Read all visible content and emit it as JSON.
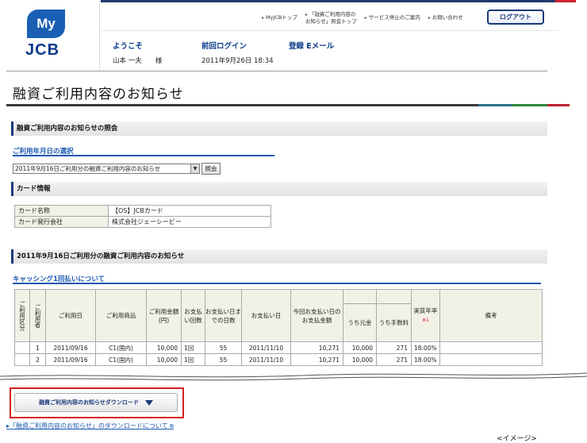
{
  "brand": {
    "top": "My",
    "bottom": "JCB"
  },
  "topnav": {
    "links": [
      "MyJCBトップ",
      "「融資ご利用内容の\nお知らせ」照会トップ",
      "サービス停止のご案内",
      "お問い合わせ"
    ],
    "logout": "ログアウト"
  },
  "user": {
    "welcome_label": "ようこそ",
    "name": "山本 一夫　　様",
    "last_login_label": "前回ログイン",
    "last_login": "2011年9月26日 18:34",
    "email_label": "登録 Eメール"
  },
  "page_title": "融資ご利用内容のお知らせ",
  "sections": {
    "inquiry": "融資ご利用内容のお知らせの照会",
    "select_title": "ご利用年月日の選択",
    "select_value": "2011年9月16日ご利用分の融資ご利用内容のお知らせ",
    "inquiry_button": "照会",
    "card_info": "カード情報",
    "detail": "2011年9月16日ご利用分の融資ご利用内容のお知らせ",
    "cashing": "キャッシング1回払いについて"
  },
  "card": {
    "rows": [
      {
        "k": "カード名称",
        "v": "【OS】JCBカード"
      },
      {
        "k": "カード発行会社",
        "v": "株式会社ジェーシービー"
      }
    ]
  },
  "table": {
    "headers": {
      "kubun": "ご利用区分",
      "user": "ご利用者",
      "date": "ご利用日",
      "product": "ご利用商品",
      "amount": "ご利用金額(円)",
      "count": "お支払い回数",
      "days": "お支払い日までの日数",
      "paydate": "お支払い日",
      "total": "今回お支払い日のお支払金額",
      "principal": "うち元金",
      "fee": "うち手数料",
      "rate": "実質年率",
      "rate_note": "※1",
      "memo": "備考"
    },
    "rows": [
      {
        "user": "1",
        "date": "2011/09/16",
        "product": "C1(国内)",
        "amount": "10,000",
        "count": "1回",
        "days": "55",
        "paydate": "2011/11/10",
        "total": "10,271",
        "principal": "10,000",
        "fee": "271",
        "rate": "18.00%",
        "memo": ""
      },
      {
        "user": "2",
        "date": "2011/09/16",
        "product": "C1(国内)",
        "amount": "10,000",
        "count": "1回",
        "days": "55",
        "paydate": "2011/11/10",
        "total": "10,271",
        "principal": "10,000",
        "fee": "271",
        "rate": "18.00%",
        "memo": ""
      }
    ]
  },
  "download": {
    "button": "融資ご利用内容のお知らせダウンロード",
    "link": "「融資ご利用内容のお知らせ」のダウンロードについて"
  },
  "image_note": "<イメージ>"
}
